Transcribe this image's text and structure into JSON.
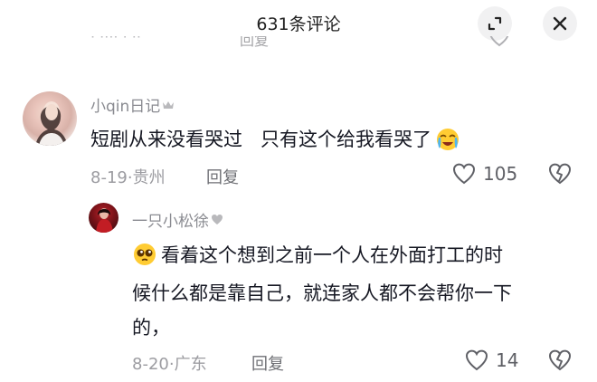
{
  "header": {
    "title": "631条评论",
    "expand_icon": "expand-icon",
    "close_icon": "close-icon"
  },
  "partial_comment": {
    "reply_label": "回复"
  },
  "comments": [
    {
      "username": "小qin日记",
      "badge_icon": "crown-icon",
      "text": "短剧从来没看哭过   只有这个给我看哭了",
      "emoji_icon": "crying-emoji-icon",
      "date_location": "8-19·贵州",
      "reply_label": "回复",
      "likes": "105"
    },
    {
      "username": "一只小松徐",
      "badge_icon": "heart-icon",
      "emoji_icon": "pleading-emoji-icon",
      "text_lines": [
        "看着这个想到之前一个人在外面打工的时",
        "候什么都是靠自己，就连家人都不会帮你一下",
        "的，"
      ],
      "date_location": "8-20·广东",
      "reply_label": "回复",
      "likes": "14"
    }
  ],
  "colors": {
    "text": "#161823",
    "meta": "#9c9ca1",
    "username": "#8a8b91",
    "button_bg": "#f1f1f2"
  }
}
